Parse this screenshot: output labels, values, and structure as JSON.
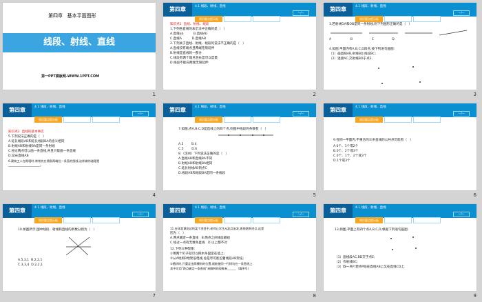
{
  "header": {
    "chapter": "第四章",
    "section": "4.1  线段、射线、直线",
    "tabs": [
      "知识要点提示板",
      "课堂练习提升板",
      "课后巩固提升板"
    ],
    "page_chip": "—/—"
  },
  "slides": [
    {
      "num": "1",
      "chapter_line": "第四章   基本平面图形",
      "title": "线段、射线、直线",
      "footer": "第一PPT模板网-WWW.1PPT.COM"
    },
    {
      "num": "2",
      "lines": [
        {
          "t": "知识点1  直线、射线、线段",
          "c": "red"
        },
        {
          "t": "1.下列各直线的表示法中正确的是（   ）"
        },
        {
          "t": "A.直线ab          B.直线Ab"
        },
        {
          "t": "C.直线A          D.直线AB"
        },
        {
          "t": "2.下列关于直线、射线、线段的说法不正确的是（   ）"
        },
        {
          "t": "A.直线没有端点且两端无限延伸"
        },
        {
          "t": "B.射线是直线的一部分"
        },
        {
          "t": "C.线段有两个端点且长度可以度量"
        },
        {
          "t": "D.线段不能向两端无限延伸"
        }
      ]
    },
    {
      "num": "3",
      "lines": [
        {
          "t": "3.若射线OA和OB是同一条射线,则下列图形正确的是（   ）"
        },
        {
          "t": "A                   B                   C                  D"
        },
        {
          "t": ""
        },
        {
          "t": "4.如图,平面内有A,B,C,D四点,按下列语句画图:"
        },
        {
          "t": "（1）画直线AB,射线BD,线段BC;"
        },
        {
          "t": "（2）连接AC,交射线BD于点E."
        }
      ]
    },
    {
      "num": "4",
      "lines": [
        {
          "t": "知识点2  直线的基本事实",
          "c": "red"
        },
        {
          "t": "5.下列说法正确的是（   ）"
        },
        {
          "t": "A.延长线段AB和延长线段BA的含义相同"
        },
        {
          "t": "B.射线AB和射线BA是同一条射线"
        },
        {
          "t": "C.经过两点可以画一条直线,并且只能画一条直线"
        },
        {
          "t": "D.延长直线AB"
        },
        {
          "t": "6.建筑工人在砌墙时,常常先在墙角两端拉一条直的细线,这样做的道理是"
        },
        {
          "t": "____________________。"
        }
      ]
    },
    {
      "num": "5",
      "lines": [
        {
          "t": "7.如图,点A,B,C,D是直线上的四个点,则图中线段的条数有（   ）"
        },
        {
          "t": "A.3        B.4"
        },
        {
          "t": "C.5        D.6"
        },
        {
          "t": "8.（滨州）下列说法正确的是（   ）"
        },
        {
          "t": "A.直线AB和直线BA不同"
        },
        {
          "t": "B.射线AB和射线BA相同"
        },
        {
          "t": "C.延长射线AB到点C"
        },
        {
          "t": "D.线段AB和线段BA是同一条线段"
        }
      ]
    },
    {
      "num": "6",
      "lines": [
        {
          "t": "9.在同一平面内,不重合的三条直线的公共点可能有（   ）"
        },
        {
          "t": "A.0个、1个或2个"
        },
        {
          "t": "B.0个、2个或3个"
        },
        {
          "t": "C.0个、1个、2个或3个"
        },
        {
          "t": "D.1个或3个"
        }
      ]
    },
    {
      "num": "7",
      "lines": [
        {
          "t": "10.如图所示,图中线段、射线和直线的条数分别为（   ）"
        },
        {
          "t": "A.5,3,1  B.2,2,1"
        },
        {
          "t": "C.3,3,4  D.2,2,1"
        }
      ]
    },
    {
      "num": "8",
      "lines": [
        {
          "t": "11.在体育课测试的某个项目中,老师让学生从起点出发,直线跑到终点,这是"
        },
        {
          "t": "因为（   ）"
        },
        {
          "t": "A.两点确定一条直线   B.两点之间线段最短"
        },
        {
          "t": "C.经过一点有无数条直线   D.以上都不对"
        },
        {
          "t": "12.下列三种现象:"
        },
        {
          "t": "①用两个钉子就可以把木条固定在墙上;"
        },
        {
          "t": "②从A地到B地架设电线,总是尽可能沿着线段AB架设;"
        },
        {
          "t": "③植树时,只要定出两棵树的位置,就能使同一行树坑在一条直线上."
        },
        {
          "t": "其中可用\"两点确定一条直线\"来解释的现象有______（填序号）"
        }
      ]
    },
    {
      "num": "9",
      "lines": [
        {
          "t": "13.如图,平面上有四个点A,B,C,D,根据下列语句画图:"
        },
        {
          "t": "（1）画线段AC,BD交于点E;"
        },
        {
          "t": "（2）作射线BC;"
        },
        {
          "t": "（3）取一点P,使点P既在直线AB上又在直线CD上."
        }
      ]
    }
  ]
}
